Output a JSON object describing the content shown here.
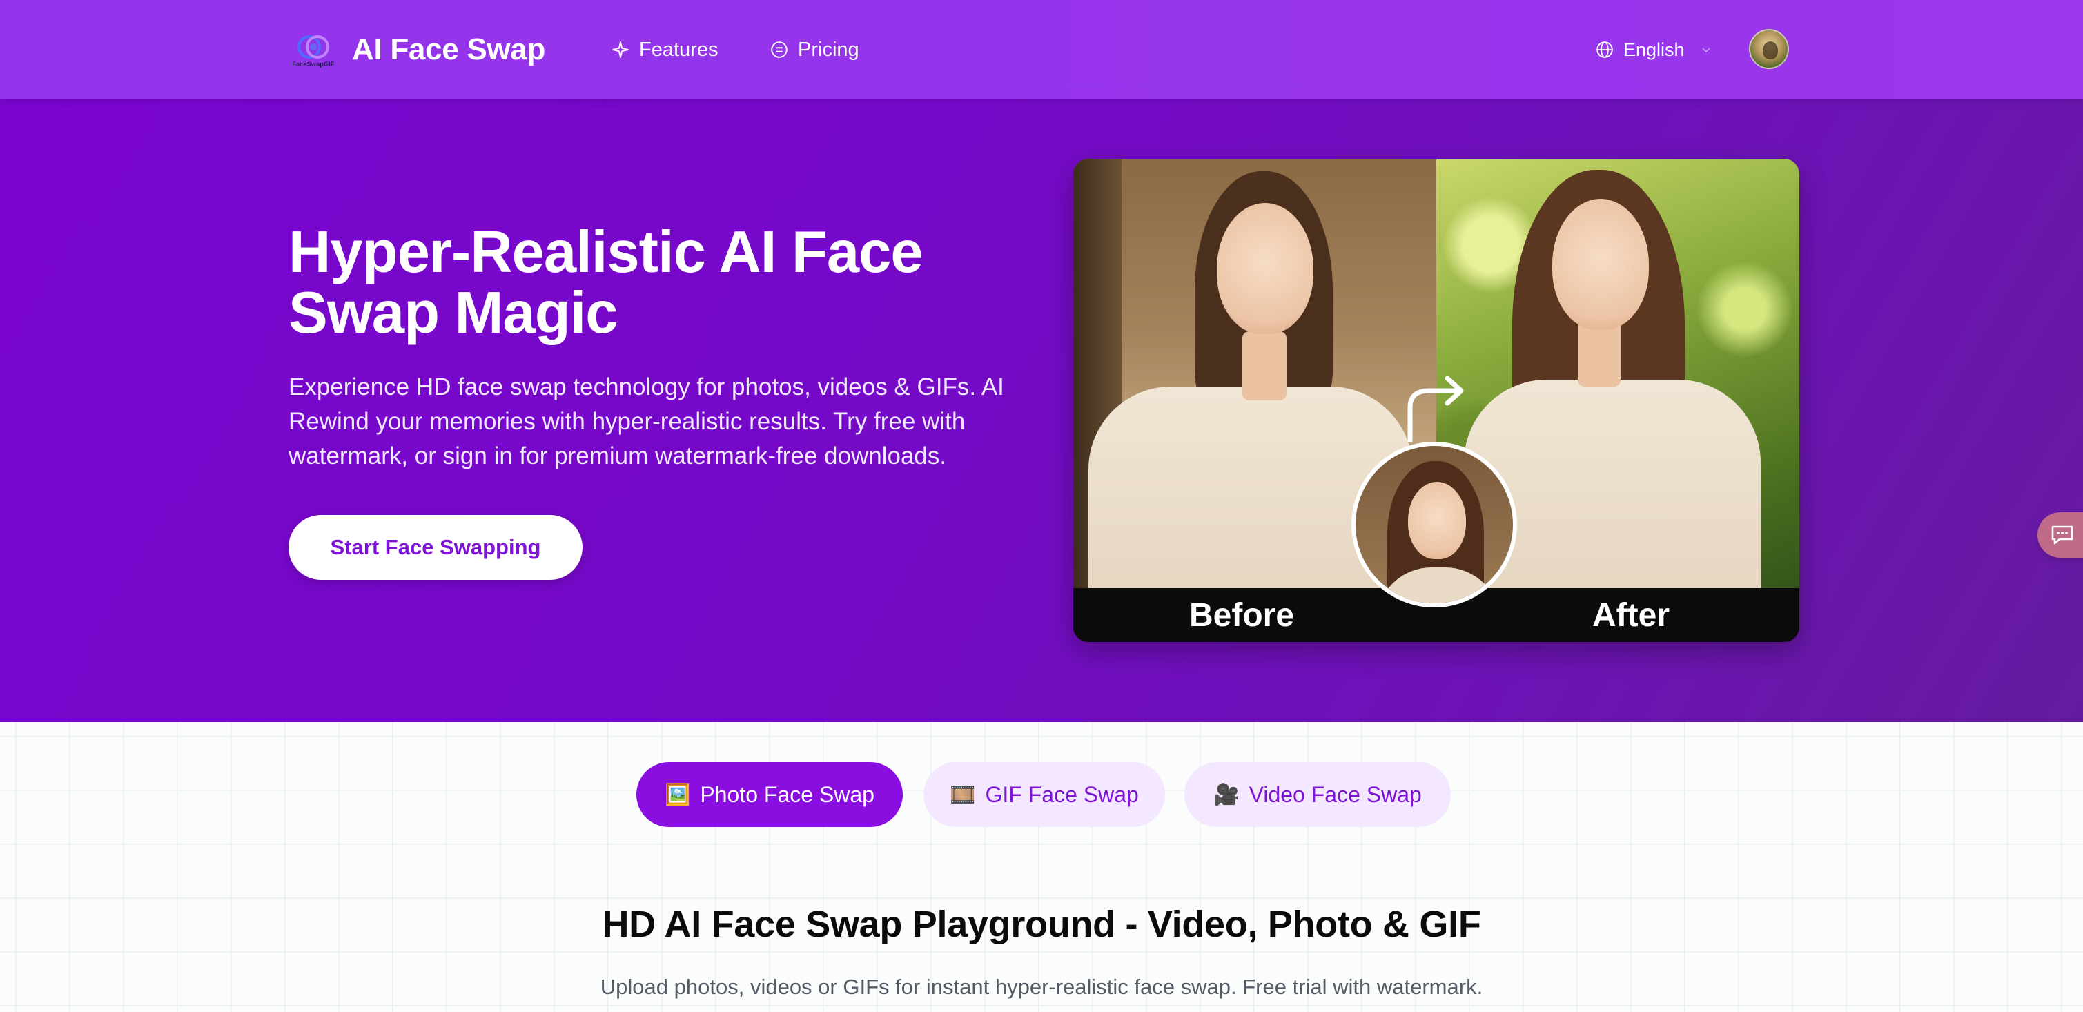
{
  "header": {
    "logo_caption": "FaceSwapGIF",
    "brand": "AI Face Swap",
    "nav": [
      {
        "label": "Features",
        "icon": "sparkle-icon"
      },
      {
        "label": "Pricing",
        "icon": "list-circle-icon"
      }
    ],
    "language": {
      "label": "English",
      "icon": "globe-icon"
    },
    "avatar": "user-avatar"
  },
  "hero": {
    "title": "Hyper-Realistic AI Face Swap Magic",
    "description": "Experience HD face swap technology for photos, videos & GIFs. AI Rewind your memories with hyper-realistic results. Try free with watermark, or sign in for premium watermark-free downloads.",
    "cta_label": "Start Face Swapping",
    "before_label": "Before",
    "after_label": "After"
  },
  "tabs": [
    {
      "emoji": "🖼️",
      "label": "Photo Face Swap",
      "active": true
    },
    {
      "emoji": "🎞️",
      "label": "GIF Face Swap",
      "active": false
    },
    {
      "emoji": "🎥",
      "label": "Video Face Swap",
      "active": false
    }
  ],
  "playground": {
    "title": "HD AI Face Swap Playground - Video, Photo & GIF",
    "subtitle": "Upload photos, videos or GIFs for instant hyper-realistic face swap. Free trial with watermark."
  },
  "colors": {
    "header_bg": "#9333ea",
    "hero_bg": "#7a05cf",
    "accent": "#8a0ee0",
    "tab_inactive_bg": "#f3e8ff",
    "chat_tab": "#c06a8a"
  }
}
